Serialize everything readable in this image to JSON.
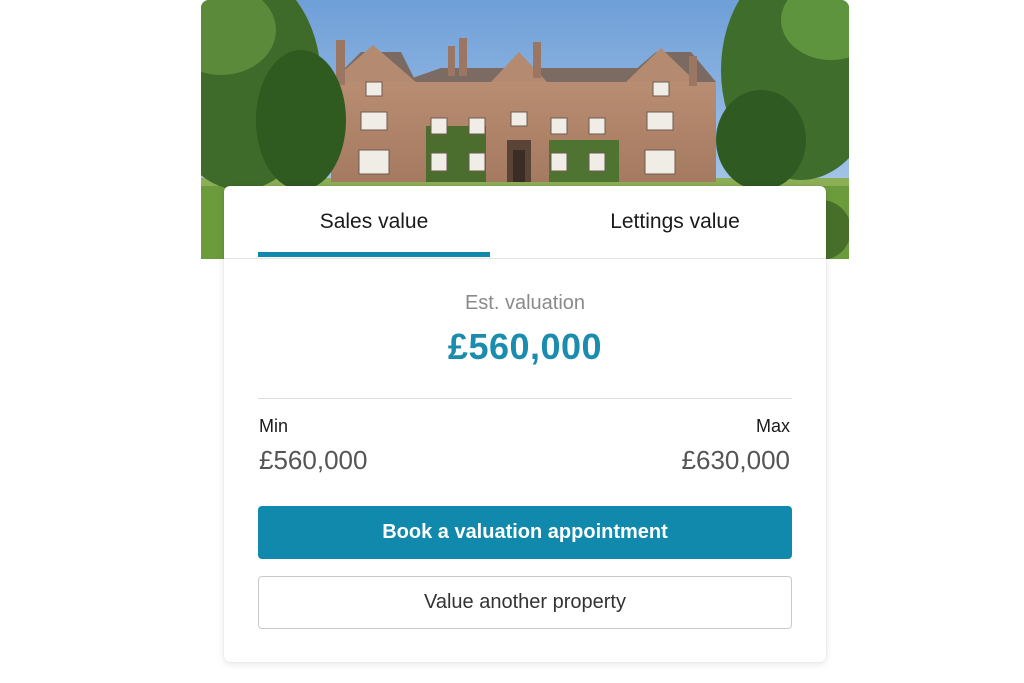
{
  "hero": {
    "image": "country-manor-house-photo"
  },
  "tabs": [
    {
      "label": "Sales value",
      "active": true
    },
    {
      "label": "Lettings value",
      "active": false
    }
  ],
  "valuation": {
    "label": "Est. valuation",
    "amount": "£560,000"
  },
  "range": {
    "min_label": "Min",
    "min_value": "£560,000",
    "max_label": "Max",
    "max_value": "£630,000"
  },
  "actions": {
    "primary_label": "Book a valuation appointment",
    "secondary_label": "Value another property"
  },
  "colors": {
    "accent": "#1089ad",
    "valuation_text": "#1a8cad"
  }
}
